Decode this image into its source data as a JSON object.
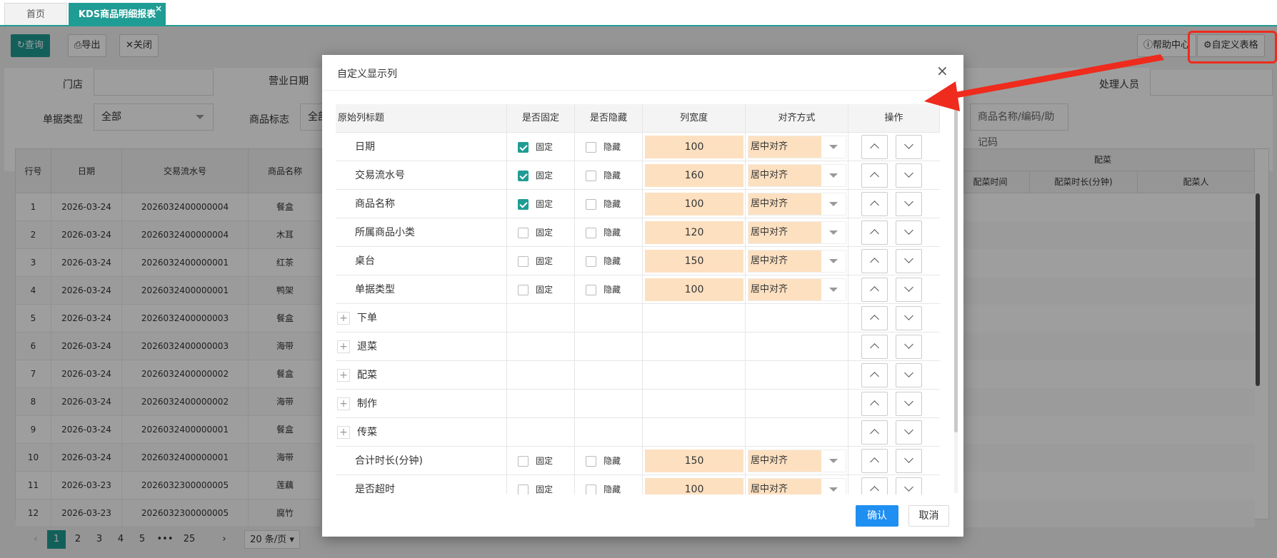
{
  "tabs": [
    {
      "label": "首页"
    },
    {
      "label": "KDS商品明细报表",
      "close": "×"
    }
  ],
  "toolbar": {
    "query": "查询",
    "export": "导出",
    "close": "关闭",
    "help": "帮助中心",
    "custom_table": "自定义表格"
  },
  "filters": {
    "store_label": "门店",
    "store_value": "",
    "bizdate_label": "营业日期",
    "handler_label": "处理人员",
    "doctype_label": "单据类型",
    "doctype_value": "全部",
    "goodsflag_label": "商品标志",
    "goodsflag_value": "全部",
    "search_placeholder": "商品名称/编码/助记码"
  },
  "grid": {
    "headers": [
      "行号",
      "日期",
      "交易流水号",
      "商品名称"
    ],
    "right_group": "配菜",
    "right_sub": [
      "配菜时间",
      "配菜时长(分钟)",
      "配菜人"
    ],
    "rows": [
      [
        "1",
        "2026-03-24",
        "2026032400000004",
        "餐盒"
      ],
      [
        "2",
        "2026-03-24",
        "2026032400000004",
        "木耳"
      ],
      [
        "3",
        "2026-03-24",
        "2026032400000001",
        "红茶"
      ],
      [
        "4",
        "2026-03-24",
        "2026032400000001",
        "鸭架"
      ],
      [
        "5",
        "2026-03-24",
        "2026032400000003",
        "餐盒"
      ],
      [
        "6",
        "2026-03-24",
        "2026032400000003",
        "海带"
      ],
      [
        "7",
        "2026-03-24",
        "2026032400000002",
        "餐盒"
      ],
      [
        "8",
        "2026-03-24",
        "2026032400000002",
        "海带"
      ],
      [
        "9",
        "2026-03-24",
        "2026032400000001",
        "餐盒"
      ],
      [
        "10",
        "2026-03-24",
        "2026032400000001",
        "海带"
      ],
      [
        "11",
        "2026-03-23",
        "2026032300000005",
        "莲藕"
      ],
      [
        "12",
        "2026-03-23",
        "2026032300000005",
        "腐竹"
      ]
    ]
  },
  "pager": {
    "pages": [
      "1",
      "2",
      "3",
      "4",
      "5",
      "•••",
      "25"
    ],
    "current": "1",
    "page_size": "20 条/页"
  },
  "modal": {
    "title": "自定义显示列",
    "close": "×",
    "headers": [
      "原始列标题",
      "是否固定",
      "是否隐藏",
      "列宽度",
      "对齐方式",
      "操作"
    ],
    "fixed_label": "固定",
    "hidden_label": "隐藏",
    "rows": [
      {
        "title": "日期",
        "fixed": true,
        "hidden": false,
        "width": "100",
        "align": "居中对齐"
      },
      {
        "title": "交易流水号",
        "fixed": true,
        "hidden": false,
        "width": "160",
        "align": "居中对齐"
      },
      {
        "title": "商品名称",
        "fixed": true,
        "hidden": false,
        "width": "100",
        "align": "居中对齐"
      },
      {
        "title": "所属商品小类",
        "fixed": false,
        "hidden": false,
        "width": "120",
        "align": "居中对齐"
      },
      {
        "title": "桌台",
        "fixed": false,
        "hidden": false,
        "width": "150",
        "align": "居中对齐"
      },
      {
        "title": "单据类型",
        "fixed": false,
        "hidden": false,
        "width": "100",
        "align": "居中对齐"
      },
      {
        "title": "下单",
        "group": true
      },
      {
        "title": "退菜",
        "group": true
      },
      {
        "title": "配菜",
        "group": true
      },
      {
        "title": "制作",
        "group": true
      },
      {
        "title": "传菜",
        "group": true
      },
      {
        "title": "合计时长(分钟)",
        "fixed": false,
        "hidden": false,
        "width": "150",
        "align": "居中对齐"
      },
      {
        "title": "是否超时",
        "fixed": false,
        "hidden": false,
        "width": "100",
        "align": "居中对齐"
      }
    ],
    "ok": "确认",
    "cancel": "取消"
  },
  "colors": {
    "accent": "#1f9c94",
    "annotation": "#ee2b1c",
    "confirm": "#1f8ff1",
    "width_fill": "#fde0c0"
  }
}
